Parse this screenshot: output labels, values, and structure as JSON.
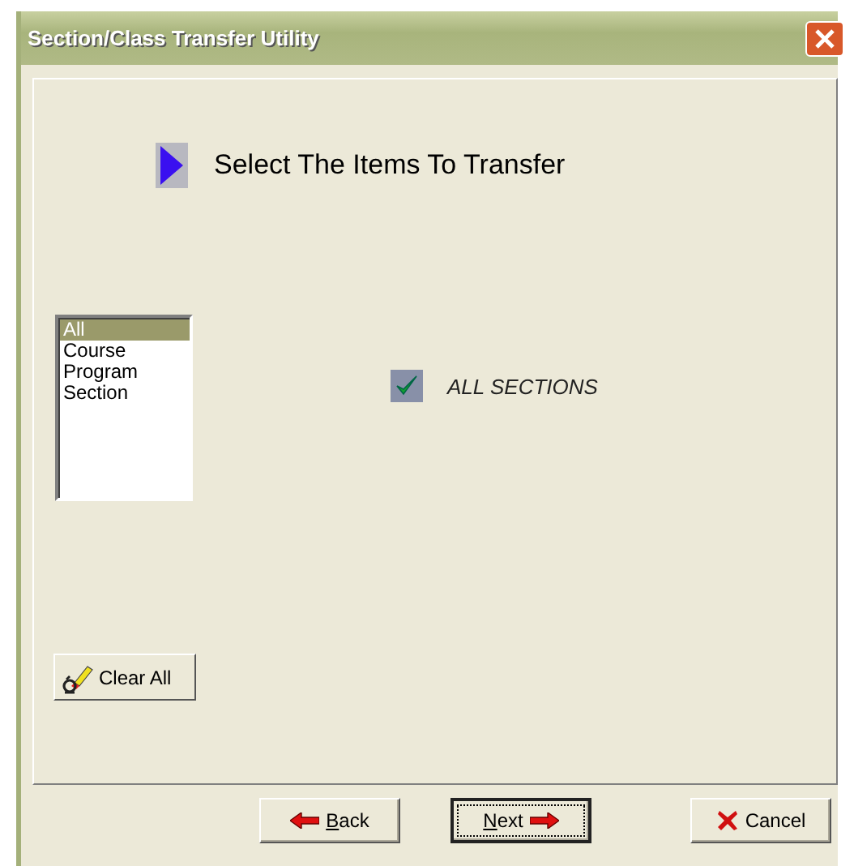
{
  "window": {
    "title": "Section/Class Transfer Utility"
  },
  "heading": "Select The Items To Transfer",
  "list": {
    "items": [
      {
        "label": "All",
        "selected": true
      },
      {
        "label": "Course",
        "selected": false
      },
      {
        "label": "Program",
        "selected": false
      },
      {
        "label": "Section",
        "selected": false
      }
    ]
  },
  "option": {
    "label": "ALL SECTIONS",
    "checked": true
  },
  "clear_button": {
    "label": "Clear All"
  },
  "buttons": [
    {
      "kind": "back",
      "label": "Back",
      "focused": false
    },
    {
      "kind": "next",
      "label": "Next",
      "focused": true
    },
    {
      "kind": "cancel",
      "label": "Cancel",
      "focused": false
    }
  ]
}
